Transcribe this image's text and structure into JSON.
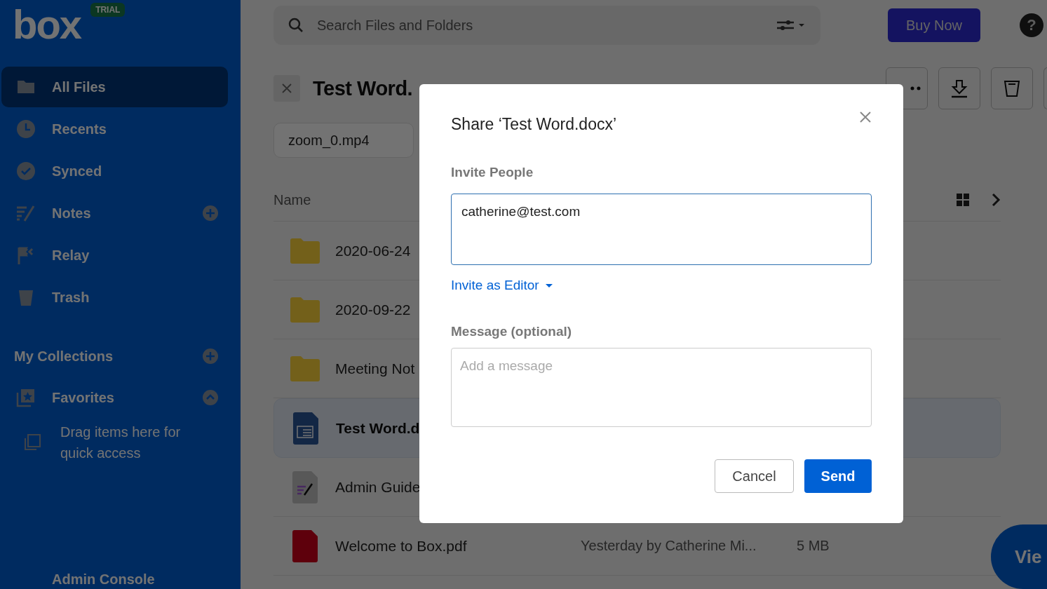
{
  "sidebar": {
    "logo": "box",
    "badge": "TRIAL",
    "items": [
      {
        "label": "All Files",
        "selected": true
      },
      {
        "label": "Recents",
        "selected": false
      },
      {
        "label": "Synced",
        "selected": false
      },
      {
        "label": "Notes",
        "selected": false
      },
      {
        "label": "Relay",
        "selected": false
      },
      {
        "label": "Trash",
        "selected": false
      }
    ],
    "collections": {
      "label": "My Collections"
    },
    "favorites": {
      "label": "Favorites",
      "expanded": true,
      "hint": "Drag items here for quick access"
    },
    "footer": "Admin Console"
  },
  "search": {
    "placeholder": "Search Files and Folders"
  },
  "buy_button": "Buy Now",
  "help": "?",
  "header": {
    "title": "Test Word."
  },
  "filter_chip": "zoom_0.mp4",
  "table": {
    "columns": [
      "Name"
    ],
    "rows": [
      {
        "name": "2020-06-24",
        "kind": "folder",
        "selected": false
      },
      {
        "name": "2020-09-22",
        "kind": "folder",
        "selected": false
      },
      {
        "name": "Meeting Not",
        "kind": "folder",
        "selected": false
      },
      {
        "name": "Test Word.d",
        "kind": "word",
        "selected": true
      },
      {
        "name": "Admin Guide",
        "kind": "note",
        "selected": false
      },
      {
        "name": "Welcome to Box.pdf",
        "kind": "pdf",
        "selected": false,
        "modified": "Yesterday by Catherine Mi...",
        "size": "5 MB"
      }
    ]
  },
  "view_button": "Vie",
  "dialog": {
    "title": "Share ‘Test Word.docx’",
    "invite_label": "Invite People",
    "invite_value": "catherine@test.com",
    "role_link": "Invite as Editor",
    "message_label": "Message (optional)",
    "message_placeholder": "Add a message",
    "buttons": [
      {
        "label": "Cancel",
        "kind": "secondary"
      },
      {
        "label": "Send",
        "kind": "primary"
      }
    ]
  }
}
